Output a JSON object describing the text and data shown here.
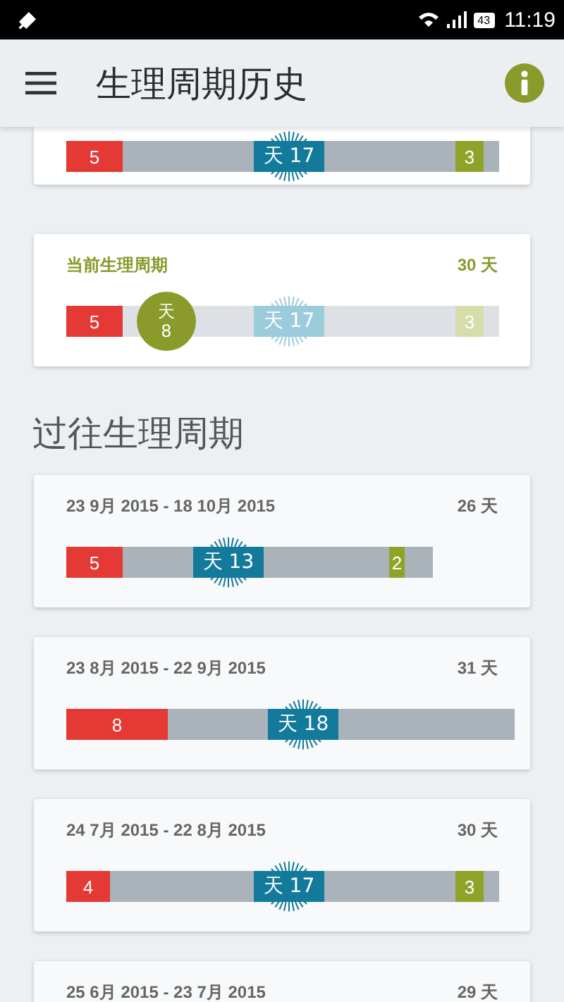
{
  "status_bar": {
    "battery": "43",
    "time": "11:19"
  },
  "app_bar": {
    "title": "生理周期历史"
  },
  "cycles": [
    {
      "kind": "partial",
      "period": "5",
      "ovulation": "天 17",
      "fertile": "3"
    },
    {
      "kind": "current",
      "label": "当前生理周期",
      "length": "30 天",
      "today": {
        "unit": "天",
        "day": "8"
      },
      "period": "5",
      "ovulation": "天 17",
      "fertile": "3"
    }
  ],
  "past_heading": "过往生理周期",
  "past_cycles": [
    {
      "dates": "23 9月 2015 - 18 10月 2015",
      "length": "26 天",
      "period": "5",
      "ovulation": "天 13",
      "fertile": "2"
    },
    {
      "dates": "23 8月 2015 - 22 9月 2015",
      "length": "31 天",
      "period": "8",
      "ovulation": "天 18"
    },
    {
      "dates": "24 7月 2015 - 22 8月 2015",
      "length": "30 天",
      "period": "4",
      "ovulation": "天 17",
      "fertile": "3"
    },
    {
      "dates": "25 6月 2015 - 23 7月 2015",
      "length": "29 天"
    }
  ]
}
